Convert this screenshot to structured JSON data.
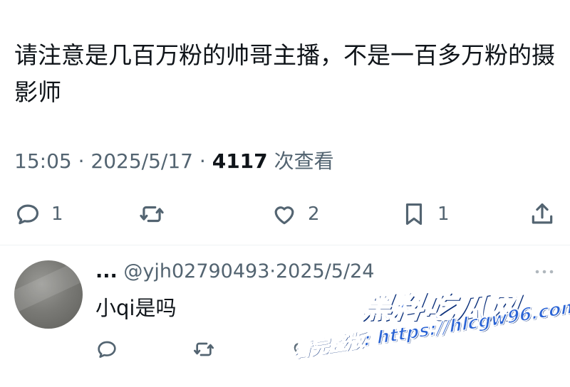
{
  "tweet": {
    "text": "请注意是几百万粉的帅哥主播，不是一百多万粉的摄影师",
    "time": "15:05",
    "date": "2025/5/17",
    "views_count": "4117",
    "views_label": "次查看",
    "separator": "·"
  },
  "actions": {
    "reply_count": "1",
    "retweet_count": "",
    "like_count": "2",
    "bookmark_count": "1"
  },
  "reply": {
    "name": "...",
    "handle": "@yjh02790493",
    "separator": "·",
    "date": "2025/5/24",
    "text": "小qi是吗"
  },
  "watermark": {
    "title": "黑料吃瓜网",
    "url_text": "看完整版: https://hlcgw96.com"
  },
  "colors": {
    "text_primary": "#0f1419",
    "text_secondary": "#536471",
    "divider": "#eff3f4",
    "watermark_blue": "#1d5bd8"
  },
  "icons": {
    "reply": "reply-icon",
    "retweet": "retweet-icon",
    "like": "heart-icon",
    "bookmark": "bookmark-icon",
    "share": "share-icon",
    "more": "more-dots-icon"
  }
}
